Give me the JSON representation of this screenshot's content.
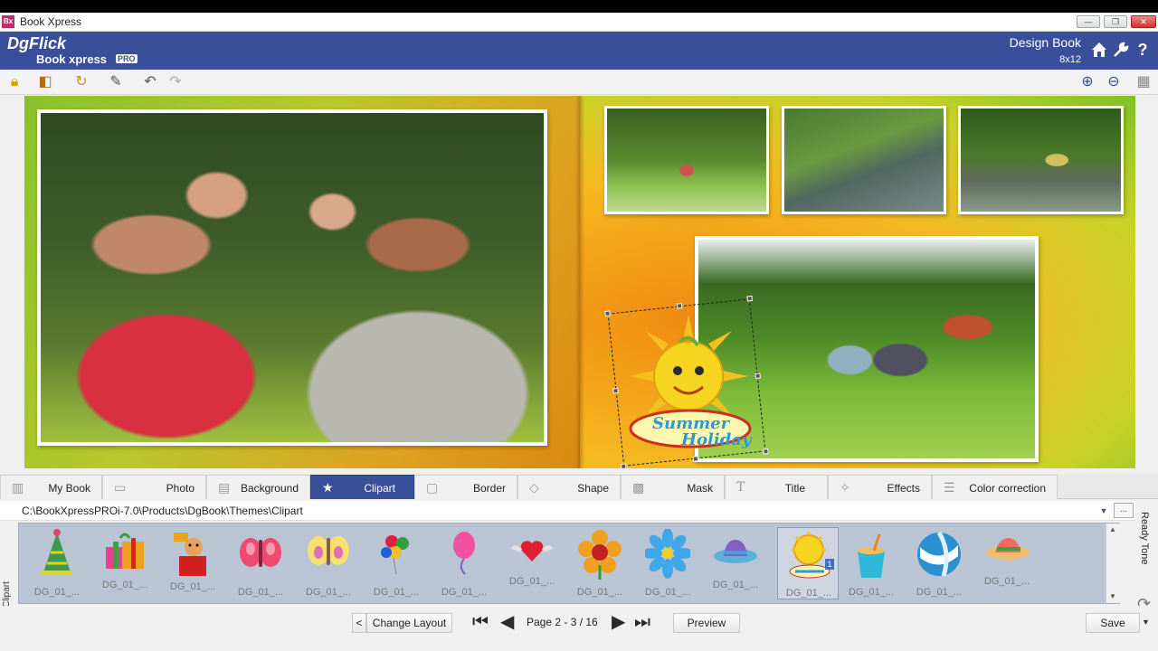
{
  "window": {
    "title": "Book Xpress",
    "app_icon": "Bx",
    "minimize": "—",
    "restore": "❐",
    "close": "✕"
  },
  "header": {
    "logo_main": "DgFlick",
    "logo_sub": "Book xpress",
    "logo_badge": "PRO",
    "design_label": "Design Book",
    "book_size": "8x12",
    "icons": [
      "home-icon",
      "wrench-icon",
      "help-icon"
    ]
  },
  "toolbar": {
    "left_icons": [
      "lock-icon",
      "layers-icon",
      "rotate-icon",
      "text-edit-icon",
      "undo-icon",
      "redo-icon"
    ],
    "right_icons": [
      "zoom-in-icon",
      "zoom-out-icon",
      "grid-icon"
    ]
  },
  "tabs": [
    {
      "label": "My Book",
      "icon": "book-icon"
    },
    {
      "label": "Photo",
      "icon": "photo-icon"
    },
    {
      "label": "Background",
      "icon": "background-icon"
    },
    {
      "label": "Clipart",
      "icon": "clipart-icon",
      "active": true
    },
    {
      "label": "Border",
      "icon": "border-icon"
    },
    {
      "label": "Shape",
      "icon": "shape-icon"
    },
    {
      "label": "Mask",
      "icon": "mask-icon"
    },
    {
      "label": "Title",
      "icon": "title-icon"
    },
    {
      "label": "Effects",
      "icon": "effects-icon"
    },
    {
      "label": "Color correction",
      "icon": "color-correction-icon"
    }
  ],
  "path": {
    "value": "C:\\BookXpressPROi-7.0\\Products\\DgBook\\Themes\\Clipart",
    "more": "..."
  },
  "side_label": "Clipart",
  "ready_tone": "Ready Tone",
  "clipart_items": [
    {
      "caption": "DG_01_...",
      "art": "party-hat"
    },
    {
      "caption": "DG_01_...",
      "art": "gift-boxes"
    },
    {
      "caption": "DG_01_...",
      "art": "jack-in-box"
    },
    {
      "caption": "DG_01_...",
      "art": "pink-butterfly"
    },
    {
      "caption": "DG_01_...",
      "art": "yellow-butterfly"
    },
    {
      "caption": "DG_01_...",
      "art": "balloons"
    },
    {
      "caption": "DG_01_...",
      "art": "pink-balloon"
    },
    {
      "caption": "DG_01_...",
      "art": "winged-heart"
    },
    {
      "caption": "DG_01_...",
      "art": "orange-flower"
    },
    {
      "caption": "DG_01_...",
      "art": "blue-flower"
    },
    {
      "caption": "DG_01_...",
      "art": "sun-hat"
    },
    {
      "caption": "DG_01_...",
      "art": "summer-holiday-sun",
      "selected": true,
      "badge": "1"
    },
    {
      "caption": "DG_01_...",
      "art": "sand-bucket"
    },
    {
      "caption": "DG_01_...",
      "art": "beach-ball"
    },
    {
      "caption": "DG_01_...",
      "art": "beach-hat"
    }
  ],
  "clipart_on_page": {
    "line1": "Summer",
    "line2": "Holiday"
  },
  "bottom": {
    "change_layout": "Change Layout",
    "change_layout_arrow": "<",
    "page_indicator": "Page 2 - 3 / 16",
    "preview": "Preview",
    "save": "Save"
  }
}
